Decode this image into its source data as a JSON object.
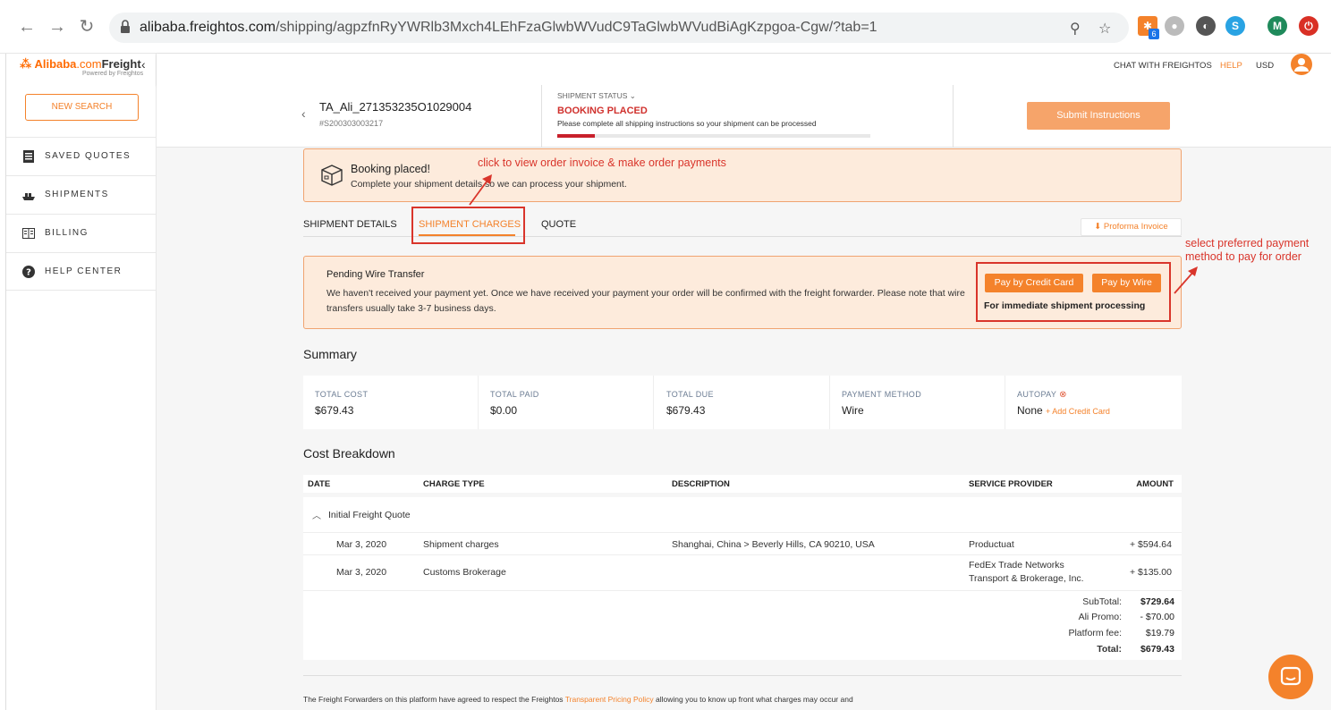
{
  "browser": {
    "url_domain": "alibaba.freightos.com",
    "url_path": "/shipping/agpzfnRyYWRlb3Mxch4LEhFzaGlwbWVudC9TaGlwbWVudBiAgKzpgoa-Cgw/?tab=1",
    "ext_badge": "6",
    "profile_initial": "M"
  },
  "sidebar": {
    "logo_brand": "Alibaba",
    "logo_com": ".com",
    "logo_freight": "Freight",
    "logo_sub": "Powered by Freightos",
    "new_search": "NEW SEARCH",
    "items": [
      {
        "label": "SAVED QUOTES"
      },
      {
        "label": "SHIPMENTS"
      },
      {
        "label": "BILLING"
      },
      {
        "label": "HELP CENTER"
      }
    ]
  },
  "topbar": {
    "chat": "CHAT WITH FREIGHTOS",
    "help": "HELP",
    "currency": "USD"
  },
  "shipment": {
    "id": "TA_Ali_271353235O1029004",
    "ref": "#S200303003217",
    "status_label": "SHIPMENT STATUS",
    "status_value": "BOOKING PLACED",
    "status_desc": "Please complete all shipping instructions so your shipment can be processed",
    "status_progress": 0.12,
    "submit": "Submit Instructions"
  },
  "booking_banner": {
    "title": "Booking placed!",
    "desc": "Complete your shipment details so we can process your shipment."
  },
  "tabs": [
    {
      "label": "SHIPMENT DETAILS"
    },
    {
      "label": "SHIPMENT CHARGES"
    },
    {
      "label": "QUOTE"
    }
  ],
  "proforma": "Proforma Invoice",
  "wire_banner": {
    "title": "Pending Wire Transfer",
    "desc": "We haven't received your payment yet. Once we have received your payment your order will be confirmed with the freight forwarder. Please note that wire transfers usually take 3-7 business days.",
    "pay_card": "Pay by Credit Card",
    "pay_wire": "Pay by Wire",
    "immediate": "For immediate shipment processing"
  },
  "summary": {
    "title": "Summary",
    "cells": [
      {
        "label": "TOTAL COST",
        "value": "$679.43"
      },
      {
        "label": "TOTAL PAID",
        "value": "$0.00"
      },
      {
        "label": "TOTAL DUE",
        "value": "$679.43"
      },
      {
        "label": "PAYMENT METHOD",
        "value": "Wire"
      },
      {
        "label": "AUTOPAY",
        "value": "None",
        "link": "+ Add Credit Card"
      }
    ]
  },
  "cost": {
    "title": "Cost Breakdown",
    "headers": [
      "DATE",
      "CHARGE TYPE",
      "DESCRIPTION",
      "SERVICE PROVIDER",
      "AMOUNT"
    ],
    "group": "Initial Freight Quote",
    "rows": [
      {
        "date": "Mar 3, 2020",
        "type": "Shipment charges",
        "desc": "Shanghai, China > Beverly Hills, CA 90210, USA",
        "provider": "Productuat",
        "provider2": "",
        "amount": "+ $594.64"
      },
      {
        "date": "Mar 3, 2020",
        "type": "Customs Brokerage",
        "desc": "",
        "provider": "FedEx Trade Networks",
        "provider2": "Transport & Brokerage, Inc.",
        "amount": "+ $135.00"
      }
    ],
    "totals": [
      {
        "label": "SubTotal:",
        "value": "$729.64"
      },
      {
        "label": "Ali Promo:",
        "value": "- $70.00"
      },
      {
        "label": "Platform fee:",
        "value": "$19.79"
      },
      {
        "label": "Total:",
        "value": "$679.43"
      }
    ]
  },
  "footer": {
    "pre": "The Freight Forwarders on this platform have agreed to respect the Freightos ",
    "link": "Transparent Pricing Policy",
    "post": " allowing you to know up front what charges may occur and"
  },
  "annotations": {
    "invoice": "click to view order invoice & make order payments",
    "payment_1": "select preferred payment",
    "payment_2": "method to pay for order"
  },
  "colors": {
    "accent": "#f4822b",
    "status_red": "#d0312d",
    "annotation": "#d9352b",
    "banner_bg": "#fdebdc"
  }
}
